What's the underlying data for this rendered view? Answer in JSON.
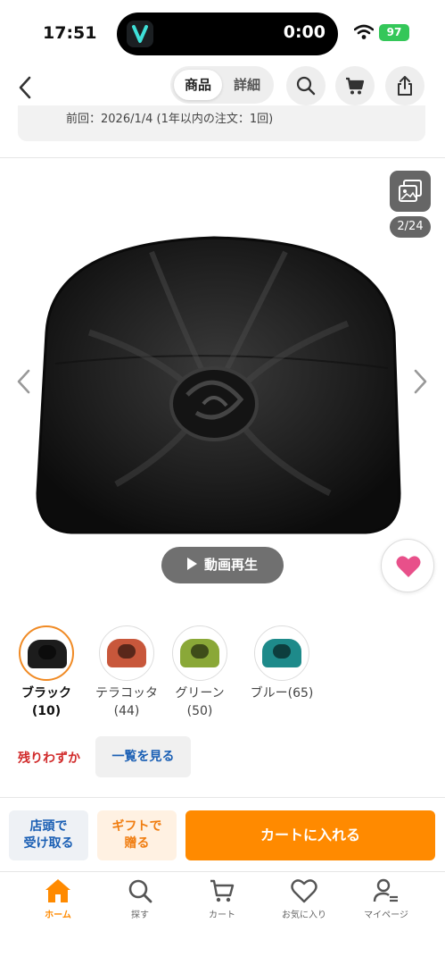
{
  "status_bar": {
    "time": "17:51",
    "timer": "0:00",
    "battery": "97"
  },
  "header": {
    "tabs": [
      {
        "label": "商品"
      },
      {
        "label": "詳細"
      }
    ]
  },
  "previous_order": "前回：2026/1/4 (1年以内の注文：1回)",
  "gallery": {
    "counter": "2/24",
    "video_button": "動画再生"
  },
  "colors": {
    "accent": "#ff8a00",
    "link": "#1a5fb4",
    "alert": "#d12a2a",
    "favorite": "#e8508a"
  },
  "variants": [
    {
      "name": "ブラック",
      "count": "(10)",
      "swatch": "#1c1c1c",
      "selected": true
    },
    {
      "name": "テラコッタ",
      "count": "(44)",
      "swatch": "#c8573b",
      "selected": false
    },
    {
      "name": "グリーン",
      "count": "(50)",
      "swatch": "#8aa838",
      "selected": false
    },
    {
      "name": "ブルー(65)",
      "count": "",
      "swatch": "#1e8a8a",
      "selected": false
    }
  ],
  "stock": {
    "status": "残りわずか",
    "list_button": "一覧を見る"
  },
  "actions": {
    "pickup_line1": "店頭で",
    "pickup_line2": "受け取る",
    "gift_line1": "ギフトで",
    "gift_line2": "贈る",
    "add_to_cart": "カートに入れる"
  },
  "tabbar": [
    {
      "label": "ホーム",
      "icon": "home-icon",
      "active": true
    },
    {
      "label": "探す",
      "icon": "search-icon",
      "active": false
    },
    {
      "label": "カート",
      "icon": "cart-icon",
      "active": false
    },
    {
      "label": "お気に入り",
      "icon": "heart-icon",
      "active": false
    },
    {
      "label": "マイページ",
      "icon": "user-icon",
      "active": false
    }
  ]
}
